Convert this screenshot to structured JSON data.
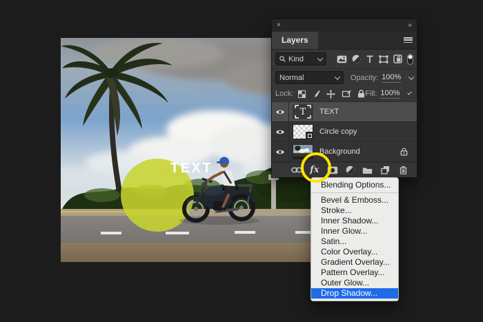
{
  "canvas": {
    "overlay_text": "TEXT",
    "circle_color": "#c8d52e"
  },
  "layers_panel": {
    "close_icon": "×",
    "collapse_icon": "«",
    "tab_label": "Layers",
    "filter_label": "Kind",
    "blend_mode": "Normal",
    "opacity_label": "Opacity:",
    "opacity_value": "100%",
    "lock_label": "Lock:",
    "fill_label": "Fill:",
    "fill_value": "100%",
    "fx_label": "fx",
    "layers": [
      {
        "name": "TEXT",
        "type": "text",
        "thumb_glyph": "T",
        "selected": true
      },
      {
        "name": "Circle copy",
        "type": "shape",
        "selected": false
      },
      {
        "name": "Background",
        "type": "image",
        "locked": true,
        "selected": false
      }
    ],
    "footer_icons": [
      "link-icon",
      "fx-button",
      "add-mask-icon",
      "adjustment-icon",
      "group-icon",
      "new-layer-icon",
      "delete-icon"
    ]
  },
  "context_menu": {
    "highlight_color": "#1f6be8",
    "items": [
      {
        "label": "Blending Options...",
        "selected": false
      },
      {
        "label": "Bevel & Emboss...",
        "selected": false
      },
      {
        "label": "Stroke...",
        "selected": false
      },
      {
        "label": "Inner Shadow...",
        "selected": false
      },
      {
        "label": "Inner Glow...",
        "selected": false
      },
      {
        "label": "Satin...",
        "selected": false
      },
      {
        "label": "Color Overlay...",
        "selected": false
      },
      {
        "label": "Gradient Overlay...",
        "selected": false
      },
      {
        "label": "Pattern Overlay...",
        "selected": false
      },
      {
        "label": "Outer Glow...",
        "selected": false
      },
      {
        "label": "Drop Shadow...",
        "selected": true
      }
    ]
  },
  "annotation": {
    "ring_color": "#ffe400"
  }
}
